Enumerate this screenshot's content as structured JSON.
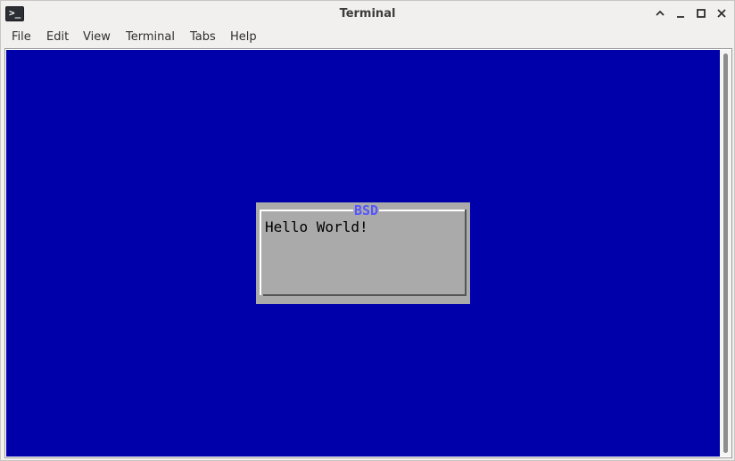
{
  "window": {
    "title": "Terminal",
    "app_icon": "terminal-icon",
    "app_icon_glyph": ">_",
    "controls": [
      {
        "name": "maximize-up-icon",
        "glyph": "^"
      },
      {
        "name": "minimize-icon",
        "glyph": "_"
      },
      {
        "name": "restore-icon",
        "glyph": "□"
      },
      {
        "name": "close-icon",
        "glyph": "×"
      }
    ]
  },
  "menubar": {
    "items": [
      "File",
      "Edit",
      "View",
      "Terminal",
      "Tabs",
      "Help"
    ]
  },
  "terminal": {
    "background_color": "#0000aa",
    "dialog": {
      "title": "BSD",
      "message": "Hello World!",
      "background_color": "#aaaaaa",
      "title_color": "#5555ff"
    }
  }
}
